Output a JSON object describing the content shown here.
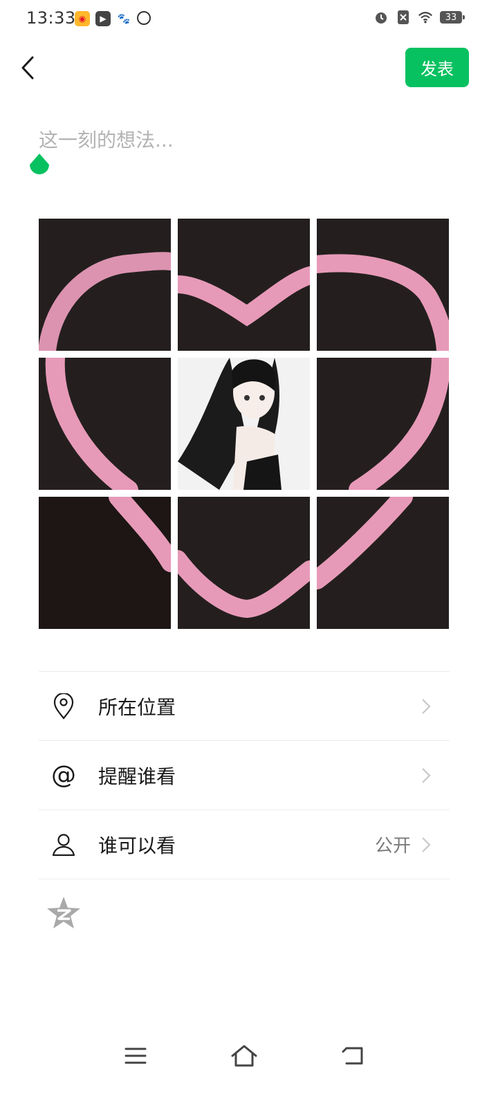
{
  "status_bar": {
    "time": "13:33",
    "battery": "33",
    "app_icons": [
      "weibo-icon",
      "video-player-icon",
      "baidu-icon",
      "wind-icon"
    ],
    "right_icons": [
      "alarm-icon",
      "notification-off-icon",
      "wifi-icon",
      "battery-icon"
    ]
  },
  "header": {
    "publish_label": "发表",
    "accent_color": "#07c160"
  },
  "composer": {
    "placeholder": "这一刻的想法..."
  },
  "images": [
    {
      "desc": "heart-top-left"
    },
    {
      "desc": "heart-top-center"
    },
    {
      "desc": "heart-top-right"
    },
    {
      "desc": "heart-middle-left"
    },
    {
      "desc": "anime-girl-portrait"
    },
    {
      "desc": "heart-middle-right"
    },
    {
      "desc": "heart-bottom-left"
    },
    {
      "desc": "heart-bottom-center"
    },
    {
      "desc": "heart-bottom-right"
    }
  ],
  "options": [
    {
      "label": "所在位置",
      "icon": "location-pin-icon",
      "value": ""
    },
    {
      "label": "提醒谁看",
      "icon": "at-sign-icon",
      "value": ""
    },
    {
      "label": "谁可以看",
      "icon": "person-icon",
      "value": "公开"
    }
  ],
  "qzone": {
    "icon": "qzone-star-icon"
  },
  "nav_bar": {
    "buttons": [
      "menu-icon",
      "home-icon",
      "back-icon"
    ]
  }
}
